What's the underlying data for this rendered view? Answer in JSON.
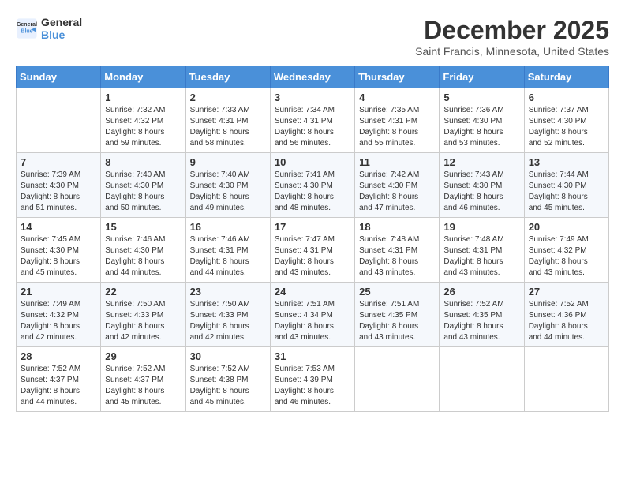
{
  "header": {
    "logo_line1": "General",
    "logo_line2": "Blue",
    "month_title": "December 2025",
    "location": "Saint Francis, Minnesota, United States"
  },
  "weekdays": [
    "Sunday",
    "Monday",
    "Tuesday",
    "Wednesday",
    "Thursday",
    "Friday",
    "Saturday"
  ],
  "weeks": [
    [
      {
        "day": "",
        "info": ""
      },
      {
        "day": "1",
        "info": "Sunrise: 7:32 AM\nSunset: 4:32 PM\nDaylight: 8 hours\nand 59 minutes."
      },
      {
        "day": "2",
        "info": "Sunrise: 7:33 AM\nSunset: 4:31 PM\nDaylight: 8 hours\nand 58 minutes."
      },
      {
        "day": "3",
        "info": "Sunrise: 7:34 AM\nSunset: 4:31 PM\nDaylight: 8 hours\nand 56 minutes."
      },
      {
        "day": "4",
        "info": "Sunrise: 7:35 AM\nSunset: 4:31 PM\nDaylight: 8 hours\nand 55 minutes."
      },
      {
        "day": "5",
        "info": "Sunrise: 7:36 AM\nSunset: 4:30 PM\nDaylight: 8 hours\nand 53 minutes."
      },
      {
        "day": "6",
        "info": "Sunrise: 7:37 AM\nSunset: 4:30 PM\nDaylight: 8 hours\nand 52 minutes."
      }
    ],
    [
      {
        "day": "7",
        "info": "Sunrise: 7:39 AM\nSunset: 4:30 PM\nDaylight: 8 hours\nand 51 minutes."
      },
      {
        "day": "8",
        "info": "Sunrise: 7:40 AM\nSunset: 4:30 PM\nDaylight: 8 hours\nand 50 minutes."
      },
      {
        "day": "9",
        "info": "Sunrise: 7:40 AM\nSunset: 4:30 PM\nDaylight: 8 hours\nand 49 minutes."
      },
      {
        "day": "10",
        "info": "Sunrise: 7:41 AM\nSunset: 4:30 PM\nDaylight: 8 hours\nand 48 minutes."
      },
      {
        "day": "11",
        "info": "Sunrise: 7:42 AM\nSunset: 4:30 PM\nDaylight: 8 hours\nand 47 minutes."
      },
      {
        "day": "12",
        "info": "Sunrise: 7:43 AM\nSunset: 4:30 PM\nDaylight: 8 hours\nand 46 minutes."
      },
      {
        "day": "13",
        "info": "Sunrise: 7:44 AM\nSunset: 4:30 PM\nDaylight: 8 hours\nand 45 minutes."
      }
    ],
    [
      {
        "day": "14",
        "info": "Sunrise: 7:45 AM\nSunset: 4:30 PM\nDaylight: 8 hours\nand 45 minutes."
      },
      {
        "day": "15",
        "info": "Sunrise: 7:46 AM\nSunset: 4:30 PM\nDaylight: 8 hours\nand 44 minutes."
      },
      {
        "day": "16",
        "info": "Sunrise: 7:46 AM\nSunset: 4:31 PM\nDaylight: 8 hours\nand 44 minutes."
      },
      {
        "day": "17",
        "info": "Sunrise: 7:47 AM\nSunset: 4:31 PM\nDaylight: 8 hours\nand 43 minutes."
      },
      {
        "day": "18",
        "info": "Sunrise: 7:48 AM\nSunset: 4:31 PM\nDaylight: 8 hours\nand 43 minutes."
      },
      {
        "day": "19",
        "info": "Sunrise: 7:48 AM\nSunset: 4:31 PM\nDaylight: 8 hours\nand 43 minutes."
      },
      {
        "day": "20",
        "info": "Sunrise: 7:49 AM\nSunset: 4:32 PM\nDaylight: 8 hours\nand 43 minutes."
      }
    ],
    [
      {
        "day": "21",
        "info": "Sunrise: 7:49 AM\nSunset: 4:32 PM\nDaylight: 8 hours\nand 42 minutes."
      },
      {
        "day": "22",
        "info": "Sunrise: 7:50 AM\nSunset: 4:33 PM\nDaylight: 8 hours\nand 42 minutes."
      },
      {
        "day": "23",
        "info": "Sunrise: 7:50 AM\nSunset: 4:33 PM\nDaylight: 8 hours\nand 42 minutes."
      },
      {
        "day": "24",
        "info": "Sunrise: 7:51 AM\nSunset: 4:34 PM\nDaylight: 8 hours\nand 43 minutes."
      },
      {
        "day": "25",
        "info": "Sunrise: 7:51 AM\nSunset: 4:35 PM\nDaylight: 8 hours\nand 43 minutes."
      },
      {
        "day": "26",
        "info": "Sunrise: 7:52 AM\nSunset: 4:35 PM\nDaylight: 8 hours\nand 43 minutes."
      },
      {
        "day": "27",
        "info": "Sunrise: 7:52 AM\nSunset: 4:36 PM\nDaylight: 8 hours\nand 44 minutes."
      }
    ],
    [
      {
        "day": "28",
        "info": "Sunrise: 7:52 AM\nSunset: 4:37 PM\nDaylight: 8 hours\nand 44 minutes."
      },
      {
        "day": "29",
        "info": "Sunrise: 7:52 AM\nSunset: 4:37 PM\nDaylight: 8 hours\nand 45 minutes."
      },
      {
        "day": "30",
        "info": "Sunrise: 7:52 AM\nSunset: 4:38 PM\nDaylight: 8 hours\nand 45 minutes."
      },
      {
        "day": "31",
        "info": "Sunrise: 7:53 AM\nSunset: 4:39 PM\nDaylight: 8 hours\nand 46 minutes."
      },
      {
        "day": "",
        "info": ""
      },
      {
        "day": "",
        "info": ""
      },
      {
        "day": "",
        "info": ""
      }
    ]
  ]
}
